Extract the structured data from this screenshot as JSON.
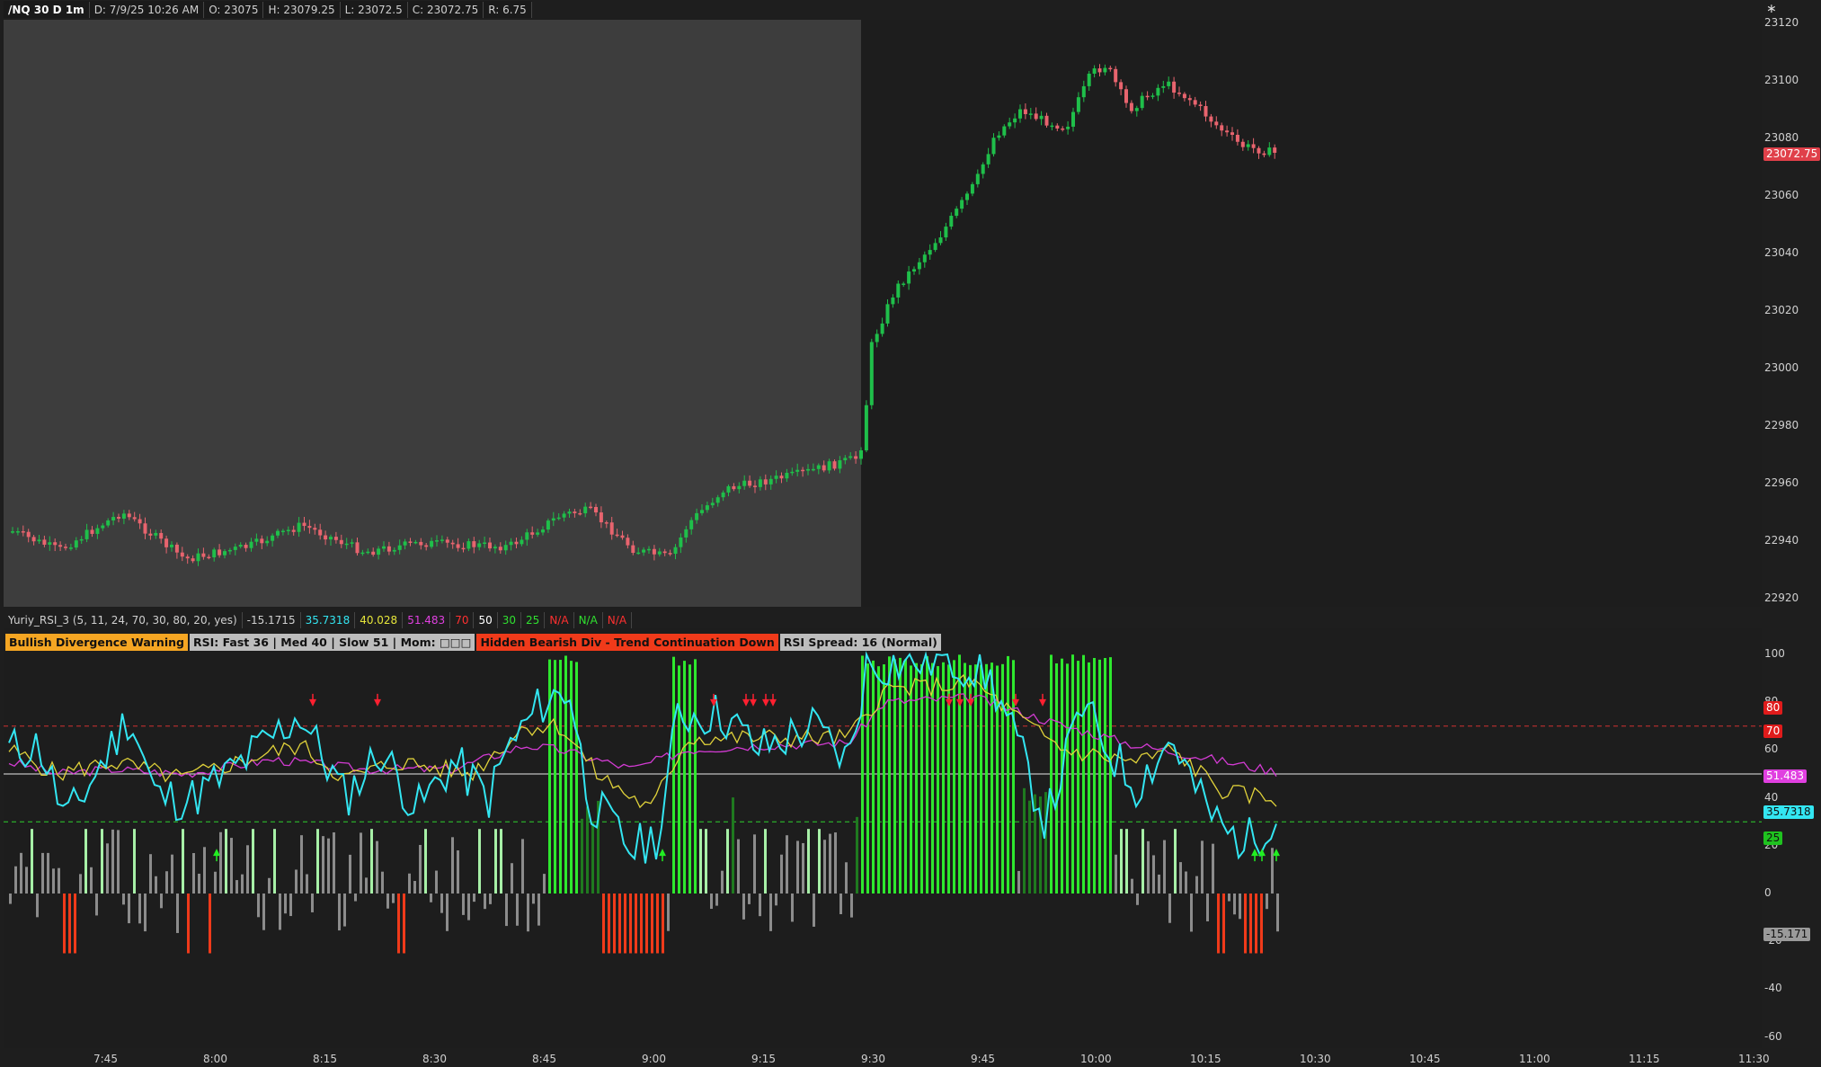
{
  "price_header": {
    "symbol": "/NQ 30 D 1m",
    "date": "D: 7/9/25 10:26 AM",
    "open": "O: 23075",
    "high": "H: 23079.25",
    "low": "L: 23072.5",
    "close": "C: 23072.75",
    "range": "R: 6.75"
  },
  "study_header": {
    "name": "Yuriy_RSI_3 (5, 11, 24, 70, 30, 80, 20, yes)",
    "values": [
      {
        "text": "-15.1715",
        "color": "#d0d0d0"
      },
      {
        "text": "35.7318",
        "color": "#33e6f2"
      },
      {
        "text": "40.028",
        "color": "#e6e63a"
      },
      {
        "text": "51.483",
        "color": "#e040e0"
      },
      {
        "text": "70",
        "color": "#ff3030"
      },
      {
        "text": "50",
        "color": "#ffffff"
      },
      {
        "text": "30",
        "color": "#30e030"
      },
      {
        "text": "25",
        "color": "#30e030"
      },
      {
        "text": "N/A",
        "color": "#ff3030"
      },
      {
        "text": "N/A",
        "color": "#30e030"
      },
      {
        "text": "N/A",
        "color": "#ff3030"
      }
    ]
  },
  "status_chips": [
    {
      "text": "Bullish Divergence Warning",
      "bg": "#f5a623",
      "fg": "#111111"
    },
    {
      "text": "RSI: Fast 36 | Med 40 | Slow 51 | Mom: □□□",
      "bg": "#bdbdbd",
      "fg": "#111111"
    },
    {
      "text": "Hidden Bearish Div - Trend Continuation Down",
      "bg": "#f03a1a",
      "fg": "#111111"
    },
    {
      "text": "RSI Spread: 16 (Normal)",
      "bg": "#bdbdbd",
      "fg": "#111111"
    }
  ],
  "price_axis": {
    "ticks": [
      "23120",
      "23100",
      "23080",
      "23060",
      "23040",
      "23020",
      "23000",
      "22980",
      "22960",
      "22940",
      "22920"
    ],
    "last_price": "23072.75",
    "last_price_color": "#e0404a"
  },
  "study_axis": {
    "ticks": [
      "100",
      "80",
      "60",
      "40",
      "20",
      "0",
      "-20",
      "-40",
      "-60"
    ],
    "tags": [
      {
        "text": "80",
        "bg": "#e01b1b",
        "fg": "#ffffff"
      },
      {
        "text": "70",
        "bg": "#e01b1b",
        "fg": "#ffffff"
      },
      {
        "text": "51.483",
        "bg": "#e040e0",
        "fg": "#ffffff"
      },
      {
        "text": "35.7318",
        "bg": "#33e6f2",
        "fg": "#111111"
      },
      {
        "text": "25",
        "bg": "#1fc21f",
        "fg": "#111111"
      },
      {
        "text": "-15.171",
        "bg": "#9a9a9a",
        "fg": "#111111"
      }
    ]
  },
  "time_axis": {
    "ticks": [
      "7:45",
      "8:00",
      "8:15",
      "8:30",
      "8:45",
      "9:00",
      "9:15",
      "9:30",
      "9:45",
      "10:00",
      "10:15",
      "10:30",
      "10:45",
      "11:00",
      "11:15",
      "11:30"
    ]
  },
  "colors": {
    "up_candle": "#1fbf4a",
    "down_candle": "#e8646e",
    "rsi_fast": "#33e6f2",
    "rsi_med": "#e0d23a",
    "rsi_slow": "#d33bd3",
    "bull_bar": "#2ee82e",
    "bear_bar": "#f03a1a"
  },
  "icons": {
    "corner": "drawing-tool-icon"
  }
}
